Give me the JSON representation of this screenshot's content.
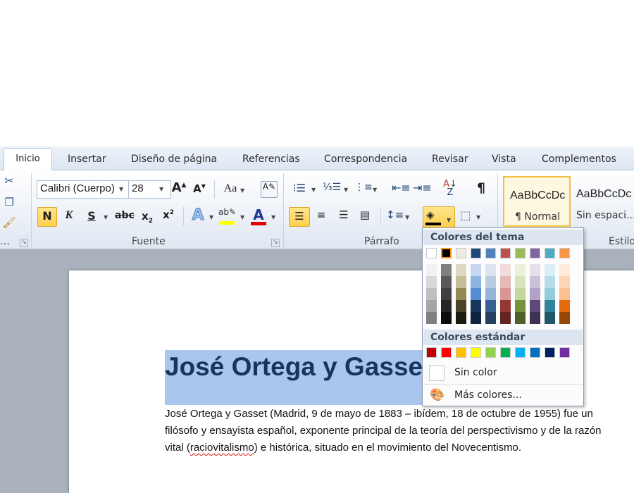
{
  "tabs": [
    "Inicio",
    "Insertar",
    "Diseño de página",
    "Referencias",
    "Correspondencia",
    "Revisar",
    "Vista",
    "Complementos"
  ],
  "font": {
    "name": "Calibri (Cuerpo)",
    "size": "28",
    "group_label": "Fuente",
    "change_case_glyph": "Aa",
    "bold_glyph": "N",
    "italic_glyph": "K",
    "underline_glyph": "S",
    "strike_glyph": "abc",
    "font_color_glyph": "A"
  },
  "paragraph": {
    "group_label": "Párrafo",
    "pilcrow": "¶"
  },
  "styles": {
    "group_label": "Estilo",
    "items": [
      {
        "sample": "AaBbCcDc",
        "name": "¶ Normal"
      },
      {
        "sample": "AaBbCcDc",
        "name": "Sin espaci..."
      }
    ]
  },
  "palette": {
    "theme_header": "Colores del tema",
    "standard_header": "Colores estándar",
    "no_color": "Sin color",
    "more_colors": "Más colores...",
    "theme_top": [
      "#ffffff",
      "#000000",
      "#eeece1",
      "#1f497d",
      "#4f81bd",
      "#c0504d",
      "#9bbb59",
      "#8064a2",
      "#4bacc6",
      "#f79646"
    ],
    "theme_shades": [
      [
        "#f2f2f2",
        "#d8d8d8",
        "#bfbfbf",
        "#a5a5a5",
        "#7f7f7f"
      ],
      [
        "#7f7f7f",
        "#595959",
        "#3f3f3f",
        "#262626",
        "#0c0c0c"
      ],
      [
        "#ddd9c3",
        "#c4bd97",
        "#938953",
        "#494429",
        "#1d1b10"
      ],
      [
        "#c6d9f0",
        "#8db3e2",
        "#548dd4",
        "#17365d",
        "#0f243e"
      ],
      [
        "#dbe5f1",
        "#b8cce4",
        "#95b3d7",
        "#366092",
        "#244061"
      ],
      [
        "#f2dcdb",
        "#e5b9b7",
        "#d99694",
        "#953734",
        "#632423"
      ],
      [
        "#ebf1dd",
        "#d7e3bc",
        "#c3d69b",
        "#76923c",
        "#4f6128"
      ],
      [
        "#e5e0ec",
        "#ccc1d9",
        "#b2a2c7",
        "#5f497a",
        "#3f3151"
      ],
      [
        "#dbeef3",
        "#b7dde8",
        "#92cddc",
        "#31859b",
        "#205867"
      ],
      [
        "#fdeada",
        "#fbd5b5",
        "#fac08f",
        "#e36c09",
        "#974806"
      ]
    ],
    "standard": [
      "#c00000",
      "#ff0000",
      "#ffc000",
      "#ffff00",
      "#92d050",
      "#00b050",
      "#00b0f0",
      "#0070c0",
      "#002060",
      "#7030a0"
    ]
  },
  "document": {
    "heading": "José Ortega y Gasset",
    "line1": "José Ortega y Gasset (Madrid, 9 de mayo de 1883 – ibídem, 18 de octubre de 1955) fue un",
    "line2": "filósofo y ensayista español, exponente principal de la teoría del perspectivismo y de la razón",
    "line3_pre": "vital (",
    "line3_misspelled": "raciovitalismo",
    "line3_post": ") e histórica, situado en el movimiento del Novecentismo."
  },
  "colors": {
    "selection": "#a9c7ee",
    "heading": "#17365d",
    "active_button": "#ffcf4e"
  },
  "icons": [
    "cut-icon",
    "copy-icon",
    "format-painter-icon",
    "grow-font-icon",
    "shrink-font-icon",
    "clear-format-icon",
    "subscript-icon",
    "superscript-icon",
    "text-effects-icon",
    "highlight-icon",
    "font-color-icon",
    "bullets-icon",
    "numbering-icon",
    "multilevel-icon",
    "decrease-indent-icon",
    "increase-indent-icon",
    "sort-icon",
    "pilcrow-icon",
    "align-left-icon",
    "align-center-icon",
    "align-right-icon",
    "justify-icon",
    "line-spacing-icon",
    "shading-icon",
    "borders-icon",
    "more-colors-icon"
  ]
}
